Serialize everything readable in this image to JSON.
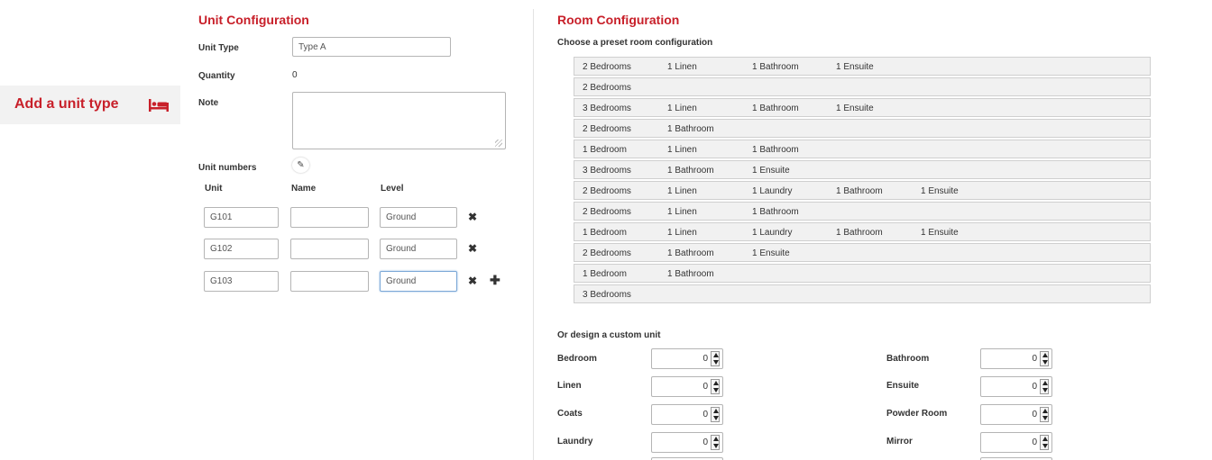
{
  "sidebar": {
    "add_unit_type": "Add a unit type",
    "icon": "bed-icon"
  },
  "unit_config": {
    "title": "Unit Configuration",
    "unit_type_label": "Unit Type",
    "unit_type_value": "Type A",
    "quantity_label": "Quantity",
    "quantity_value": "0",
    "note_label": "Note",
    "unit_numbers_label": "Unit numbers",
    "columns": {
      "unit": "Unit",
      "name": "Name",
      "level": "Level"
    },
    "units": [
      {
        "unit": "G101",
        "name": "",
        "level": "Ground"
      },
      {
        "unit": "G102",
        "name": "",
        "level": "Ground"
      },
      {
        "unit": "G103",
        "name": "",
        "level": "Ground"
      }
    ]
  },
  "room_config": {
    "title": "Room Configuration",
    "preset_heading": "Choose a preset room configuration",
    "presets": [
      [
        "2 Bedrooms",
        "1 Linen",
        "1 Bathroom",
        "1 Ensuite"
      ],
      [
        "2 Bedrooms"
      ],
      [
        "3 Bedrooms",
        "1 Linen",
        "1 Bathroom",
        "1 Ensuite"
      ],
      [
        "2 Bedrooms",
        "1 Bathroom"
      ],
      [
        "1 Bedroom",
        "1 Linen",
        "1 Bathroom"
      ],
      [
        "3 Bedrooms",
        "1 Bathroom",
        "1 Ensuite"
      ],
      [
        "2 Bedrooms",
        "1 Linen",
        "1 Laundry",
        "1 Bathroom",
        "1 Ensuite"
      ],
      [
        "2 Bedrooms",
        "1 Linen",
        "1 Bathroom"
      ],
      [
        "1 Bedroom",
        "1 Linen",
        "1 Laundry",
        "1 Bathroom",
        "1 Ensuite"
      ],
      [
        "2 Bedrooms",
        "1 Bathroom",
        "1 Ensuite"
      ],
      [
        "1 Bedroom",
        "1 Bathroom"
      ],
      [
        "3 Bedrooms"
      ]
    ],
    "custom_heading": "Or design a custom unit",
    "custom_fields": {
      "bedroom": {
        "label": "Bedroom",
        "value": "0"
      },
      "bathroom": {
        "label": "Bathroom",
        "value": "0"
      },
      "linen": {
        "label": "Linen",
        "value": "0"
      },
      "ensuite": {
        "label": "Ensuite",
        "value": "0"
      },
      "coats": {
        "label": "Coats",
        "value": "0"
      },
      "powder_room": {
        "label": "Powder Room",
        "value": "0"
      },
      "laundry": {
        "label": "Laundry",
        "value": "0"
      },
      "mirror": {
        "label": "Mirror",
        "value": "0"
      }
    }
  },
  "colors": {
    "accent": "#c8202a"
  }
}
